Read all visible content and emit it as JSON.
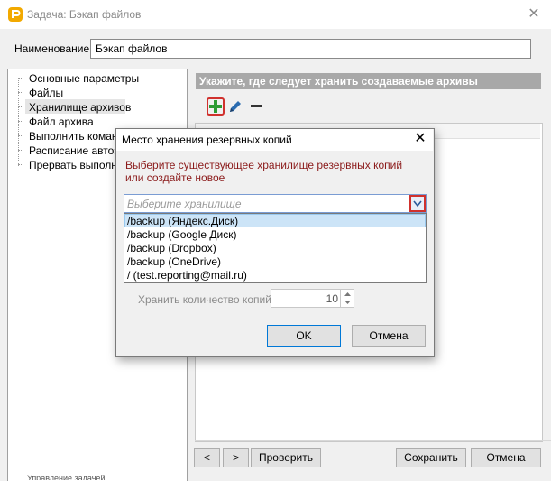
{
  "window": {
    "title": "Задача: Бэкап файлов"
  },
  "form": {
    "name_label": "Наименование:",
    "name_value": "Бэкап файлов"
  },
  "tree": {
    "items": [
      {
        "label": "Основные параметры"
      },
      {
        "label": "Файлы"
      },
      {
        "label": "Хранилище архивов",
        "selected": true
      },
      {
        "label": "Файл архива"
      },
      {
        "label": "Выполнить команд"
      },
      {
        "label": "Расписание автоза"
      },
      {
        "label": "Прервать выполне"
      }
    ],
    "footer_text": "Управление задачей"
  },
  "section": {
    "header": "Укажите, где следует хранить создаваемые архивы"
  },
  "toolbar": {
    "icons": [
      "add-icon",
      "edit-icon",
      "remove-icon"
    ]
  },
  "bottom": {
    "prev_label": "<",
    "next_label": ">",
    "check_label": "Проверить",
    "save_label": "Сохранить",
    "cancel_label": "Отмена"
  },
  "dialog": {
    "title": "Место хранения резервных копий",
    "message": "Выберите существующее хранилище резервных копий или создайте новое",
    "combo_placeholder": "Выберите хранилище",
    "options": [
      "/backup (Яндекс.Диск)",
      "/backup (Google Диск)",
      "/backup (Dropbox)",
      "/backup (OneDrive)",
      "/ (test.reporting@mail.ru)"
    ],
    "keep_label": "Хранить количество копий",
    "keep_value": "10",
    "ok_label": "OK",
    "cancel_label": "Отмена"
  },
  "colors": {
    "accent_red": "#d0312d",
    "message_red": "#8b1a1a",
    "add_green": "#2e9b34",
    "selection": "#cce4f7"
  }
}
